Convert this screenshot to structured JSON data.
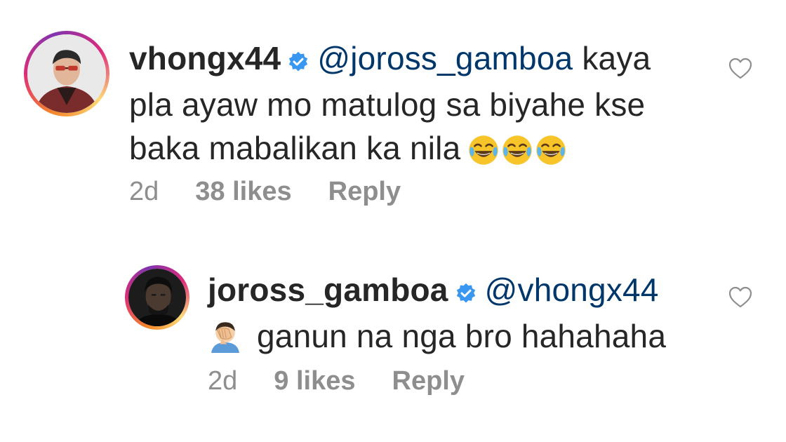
{
  "comments": [
    {
      "username": "vhongx44",
      "mention": "@joross_gamboa",
      "text_line1": "kaya",
      "text_line2": "pla ayaw mo matulog sa biyahe kse",
      "text_line3": "baka mabalikan ka nila",
      "emoji": [
        "face-with-tears-of-joy",
        "face-with-tears-of-joy",
        "face-with-tears-of-joy"
      ],
      "time": "2d",
      "likes": "38 likes",
      "reply": "Reply"
    },
    {
      "username": "joross_gamboa",
      "mention": "@vhongx44",
      "emoji": "man-facepalming",
      "text": "ganun na nga bro hahahaha",
      "time": "2d",
      "likes": "9 likes",
      "reply": "Reply"
    }
  ],
  "icons": {
    "verified": "verified-badge-icon",
    "like": "heart-outline-icon"
  },
  "colors": {
    "text": "#262626",
    "mention": "#00376b",
    "meta": "#8e8e8e",
    "verified": "#3897f0"
  }
}
